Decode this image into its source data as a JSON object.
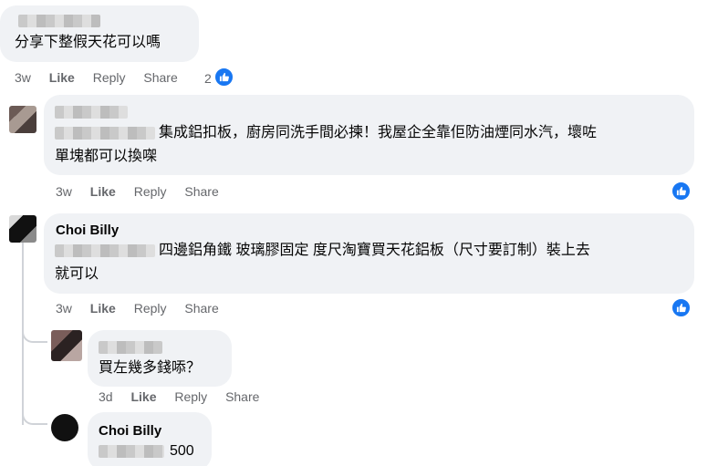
{
  "comments": [
    {
      "name": "",
      "text_lines": [
        "分享下整假天花可以嗎"
      ],
      "time": "3w",
      "like": "Like",
      "reply": "Reply",
      "share": "Share",
      "reaction_count": "2"
    },
    {
      "name": "",
      "text_lines": [
        "集成鋁扣板，廚房同洗手間必揀！我屋企全靠佢防油煙同水汽，壞咗",
        "單塊都可以換㗎"
      ],
      "time": "3w",
      "like": "Like",
      "reply": "Reply",
      "share": "Share"
    },
    {
      "name": "Choi Billy",
      "text_lines": [
        "四邊鋁角鐵 玻璃膠固定 度尺淘寶買天花鋁板（尺寸要訂制）裝上去",
        "就可以"
      ],
      "time": "3w",
      "like": "Like",
      "reply": "Reply",
      "share": "Share"
    },
    {
      "name": "",
      "text_lines": [
        "買左幾多錢㖭？"
      ],
      "time": "3d",
      "like": "Like",
      "reply": "Reply",
      "share": "Share"
    },
    {
      "name": "Choi Billy",
      "text_lines": [
        "500"
      ]
    }
  ],
  "icons": {
    "reaction": "like-thumb-icon"
  },
  "colors": {
    "bubble": "#f0f2f5",
    "meta": "#65676b",
    "like_blue": "#1877f2"
  }
}
